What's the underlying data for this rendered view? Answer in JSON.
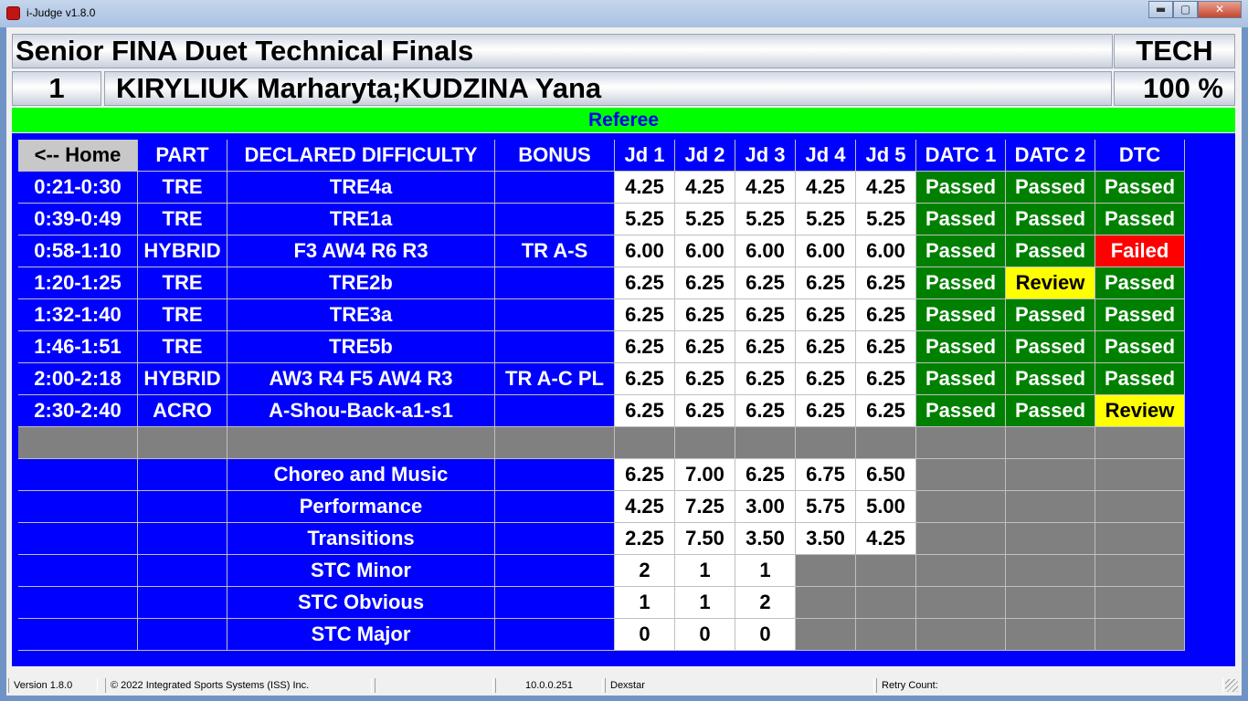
{
  "window": {
    "title": "i-Judge v1.8.0",
    "min_glyph": "▬",
    "max_glyph": "▢",
    "close_glyph": "✕"
  },
  "header": {
    "event_title": "Senior FINA Duet Technical Finals",
    "round_type": "TECH",
    "team_number": "1",
    "team_names": "KIRYLIUK Marharyta;KUDZINA Yana",
    "percent": "100 %"
  },
  "referee": "Referee",
  "table": {
    "home_button": "<-- Home",
    "headers": [
      "PART",
      "DECLARED DIFFICULTY",
      "BONUS",
      "Jd 1",
      "Jd 2",
      "Jd 3",
      "Jd 4",
      "Jd 5",
      "DATC 1",
      "DATC 2",
      "DTC"
    ],
    "rows": [
      {
        "time": "0:21-0:30",
        "part": "TRE",
        "difficulty": "TRE4a",
        "bonus": "",
        "scores": [
          "4.25",
          "4.25",
          "4.25",
          "4.25",
          "4.25"
        ],
        "datc1": "Passed",
        "datc2": "Passed",
        "dtc": "Passed"
      },
      {
        "time": "0:39-0:49",
        "part": "TRE",
        "difficulty": "TRE1a",
        "bonus": "",
        "scores": [
          "5.25",
          "5.25",
          "5.25",
          "5.25",
          "5.25"
        ],
        "datc1": "Passed",
        "datc2": "Passed",
        "dtc": "Passed"
      },
      {
        "time": "0:58-1:10",
        "part": "HYBRID",
        "difficulty": "F3 AW4 R6 R3",
        "bonus": "TR A-S",
        "scores": [
          "6.00",
          "6.00",
          "6.00",
          "6.00",
          "6.00"
        ],
        "datc1": "Passed",
        "datc2": "Passed",
        "dtc": "Failed"
      },
      {
        "time": "1:20-1:25",
        "part": "TRE",
        "difficulty": "TRE2b",
        "bonus": "",
        "scores": [
          "6.25",
          "6.25",
          "6.25",
          "6.25",
          "6.25"
        ],
        "datc1": "Passed",
        "datc2": "Review",
        "dtc": "Passed"
      },
      {
        "time": "1:32-1:40",
        "part": "TRE",
        "difficulty": "TRE3a",
        "bonus": "",
        "scores": [
          "6.25",
          "6.25",
          "6.25",
          "6.25",
          "6.25"
        ],
        "datc1": "Passed",
        "datc2": "Passed",
        "dtc": "Passed"
      },
      {
        "time": "1:46-1:51",
        "part": "TRE",
        "difficulty": "TRE5b",
        "bonus": "",
        "scores": [
          "6.25",
          "6.25",
          "6.25",
          "6.25",
          "6.25"
        ],
        "datc1": "Passed",
        "datc2": "Passed",
        "dtc": "Passed"
      },
      {
        "time": "2:00-2:18",
        "part": "HYBRID",
        "difficulty": "AW3 R4 F5 AW4 R3",
        "bonus": "TR A-C PL",
        "scores": [
          "6.25",
          "6.25",
          "6.25",
          "6.25",
          "6.25"
        ],
        "datc1": "Passed",
        "datc2": "Passed",
        "dtc": "Passed"
      },
      {
        "time": "2:30-2:40",
        "part": "ACRO",
        "difficulty": "A-Shou-Back-a1-s1",
        "bonus": "",
        "scores": [
          "6.25",
          "6.25",
          "6.25",
          "6.25",
          "6.25"
        ],
        "datc1": "Passed",
        "datc2": "Passed",
        "dtc": "Review"
      }
    ],
    "impression_rows": [
      {
        "label": "Choreo and Music",
        "scores": [
          "6.25",
          "7.00",
          "6.25",
          "6.75",
          "6.50"
        ]
      },
      {
        "label": "Performance",
        "scores": [
          "4.25",
          "7.25",
          "3.00",
          "5.75",
          "5.00"
        ]
      },
      {
        "label": "Transitions",
        "scores": [
          "2.25",
          "7.50",
          "3.50",
          "3.50",
          "4.25"
        ]
      }
    ],
    "stc_rows": [
      {
        "label": "STC Minor",
        "scores": [
          "2",
          "1",
          "1"
        ]
      },
      {
        "label": "STC Obvious",
        "scores": [
          "1",
          "1",
          "2"
        ]
      },
      {
        "label": "STC Major",
        "scores": [
          "0",
          "0",
          "0"
        ]
      }
    ]
  },
  "status_bar": {
    "version": "Version 1.8.0",
    "copyright": "© 2022 Integrated Sports Systems (ISS) Inc.",
    "ip": "10.0.0.251",
    "host": "Dexstar",
    "retry": "Retry Count:"
  },
  "colors": {
    "passed": "#008000",
    "failed": "#ff0000",
    "review": "#ffff00",
    "panel": "#0000ff",
    "referee_bar": "#00ff00"
  }
}
